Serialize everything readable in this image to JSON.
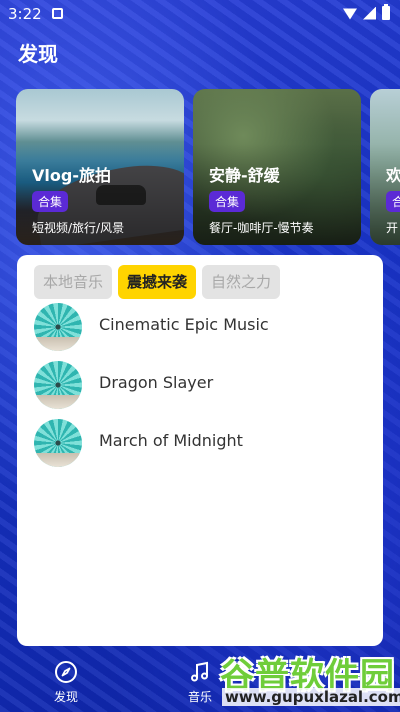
{
  "status_bar": {
    "time": "3:22"
  },
  "header": {
    "title": "发现"
  },
  "cards": [
    {
      "title": "Vlog-旅拍",
      "tag": "合集",
      "subtitle": "短视频/旅行/风景"
    },
    {
      "title": "安静-舒缓",
      "tag": "合集",
      "subtitle": "餐厅-咖啡厅-慢节奏"
    },
    {
      "title": "欢",
      "tag": "合",
      "subtitle": "开"
    }
  ],
  "tabs": [
    {
      "label": "本地音乐",
      "active": false
    },
    {
      "label": "震撼来袭",
      "active": true
    },
    {
      "label": "自然之力",
      "active": false
    }
  ],
  "tracks": [
    {
      "title": "Cinematic Epic Music"
    },
    {
      "title": "Dragon Slayer"
    },
    {
      "title": "March of Midnight"
    }
  ],
  "bottom_nav": [
    {
      "label": "发现",
      "icon": "compass-icon"
    },
    {
      "label": "音乐",
      "icon": "music-note-icon"
    }
  ],
  "watermark": {
    "title": "谷普软件园",
    "url": "www.gupuxlazal.com"
  },
  "colors": {
    "accent_yellow": "#ffd400",
    "tag_purple": "#5b2ad6",
    "background_blue": "#1733c6"
  }
}
